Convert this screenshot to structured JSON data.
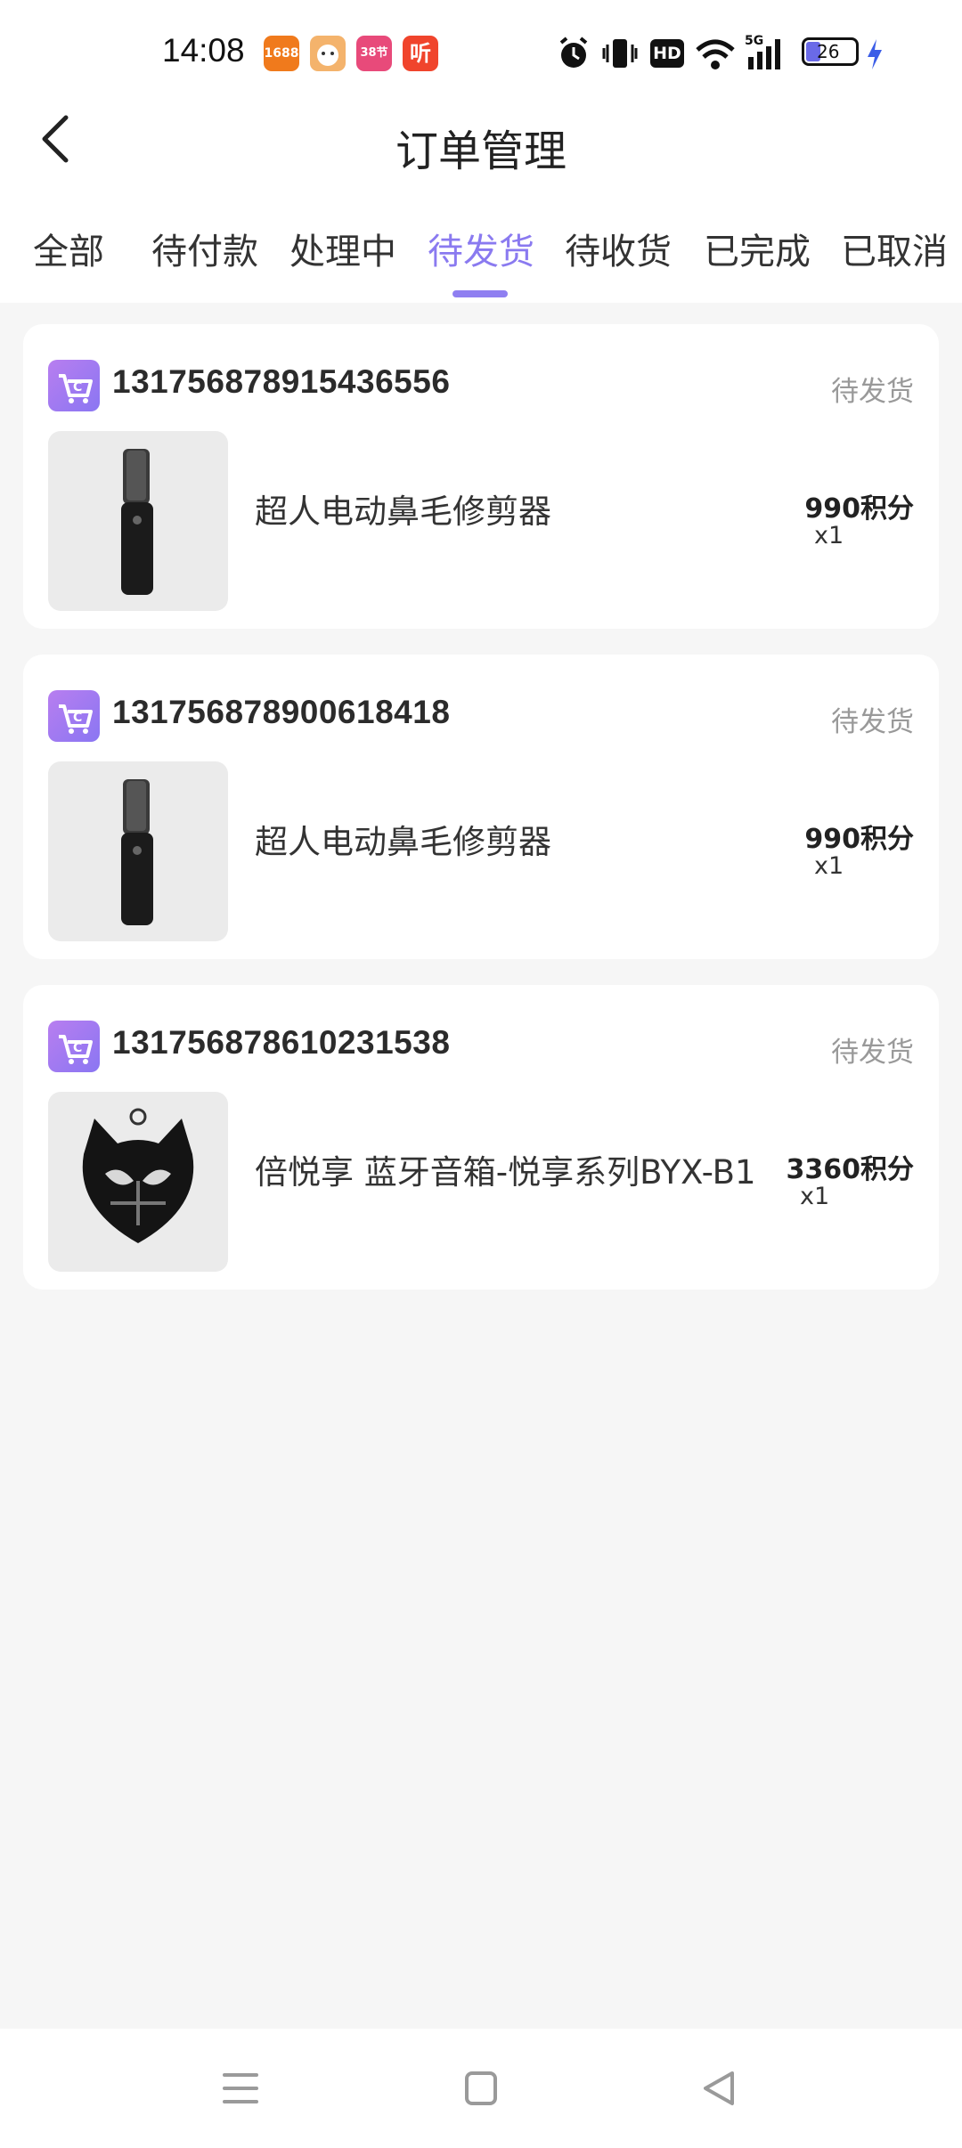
{
  "status_bar": {
    "time": "14:08",
    "apps": [
      "1688",
      "hema-icon",
      "38节",
      "听"
    ],
    "battery": "26",
    "network": "5G",
    "hd": "HD"
  },
  "header": {
    "title": "订单管理"
  },
  "tabs": [
    {
      "label": "全部"
    },
    {
      "label": "待付款"
    },
    {
      "label": "处理中"
    },
    {
      "label": "待发货"
    },
    {
      "label": "待收货"
    },
    {
      "label": "已完成"
    },
    {
      "label": "已取消"
    }
  ],
  "active_tab": "待发货",
  "orders": [
    {
      "order_no": "131756878915436556",
      "status": "待发货",
      "product_name": "超人电动鼻毛修剪器",
      "price": "990积分",
      "qty": "x1",
      "thumb_icon": "nose-trimmer-image"
    },
    {
      "order_no": "131756878900618418",
      "status": "待发货",
      "product_name": "超人电动鼻毛修剪器",
      "price": "990积分",
      "qty": "x1",
      "thumb_icon": "nose-trimmer-image"
    },
    {
      "order_no": "131756878610231538",
      "status": "待发货",
      "product_name": "倍悦享 蓝牙音箱-悦享系列BYX-B1",
      "price": "3360积分",
      "qty": "x1",
      "thumb_icon": "bluetooth-speaker-image"
    }
  ],
  "colors": {
    "accent": "#8a7af0",
    "background": "#f6f6f6",
    "status_text": "#999999"
  }
}
